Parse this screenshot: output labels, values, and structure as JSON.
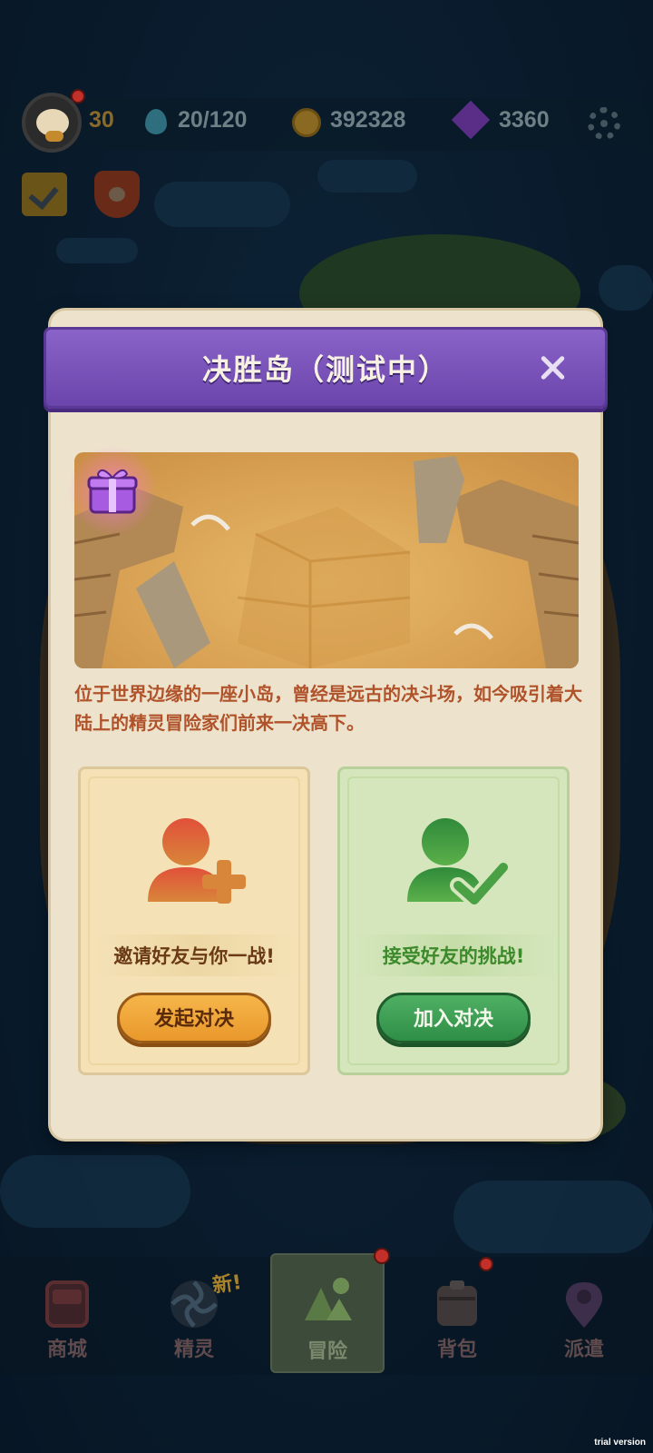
{
  "hud": {
    "level": "30",
    "stamina": "20/120",
    "coins": "392328",
    "gems": "3360"
  },
  "dialog": {
    "title": "决胜岛（测试中）",
    "description": "位于世界边缘的一座小岛，曾经是远古的决斗场，如今吸引着大陆上的精灵冒险家们前来一决高下。",
    "invite_card": {
      "label": "邀请好友与你一战!",
      "button": "发起对决"
    },
    "join_card": {
      "label": "接受好友的挑战!",
      "button": "加入对决"
    }
  },
  "nav": {
    "items": [
      {
        "label": "商城",
        "icon": "shop-icon"
      },
      {
        "label": "精灵",
        "icon": "spirit-icon",
        "badge": "新!"
      },
      {
        "label": "冒险",
        "icon": "adventure-icon",
        "active": true
      },
      {
        "label": "背包",
        "icon": "backpack-icon"
      },
      {
        "label": "派遣",
        "icon": "dispatch-icon"
      }
    ]
  },
  "watermark": "trial version",
  "colors": {
    "header_purple": "#7a55bb",
    "invite_orange": "#eea43a",
    "join_green": "#3da155",
    "description_text": "#b0522a"
  }
}
